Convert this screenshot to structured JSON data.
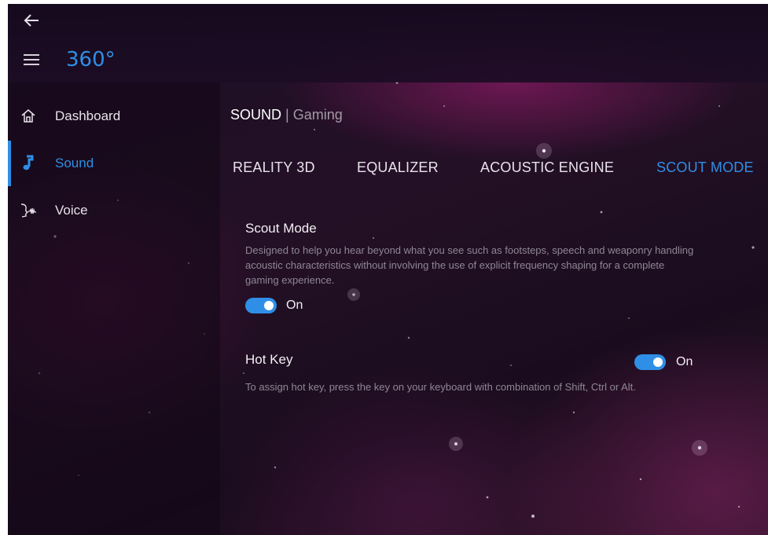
{
  "app": {
    "title": "360°",
    "back_icon": "arrow-left-icon",
    "menu_icon": "hamburger-menu-icon",
    "accent_color": "#2f8fe6"
  },
  "sidebar": {
    "items": [
      {
        "label": "Dashboard",
        "icon": "home-icon",
        "active": false
      },
      {
        "label": "Sound",
        "icon": "music-note-icon",
        "active": true
      },
      {
        "label": "Voice",
        "icon": "voice-wave-icon",
        "active": false
      }
    ]
  },
  "breadcrumb": {
    "section": "SOUND",
    "separator": "|",
    "subsection": "Gaming"
  },
  "tabs": [
    {
      "label": "REALITY 3D",
      "active": false
    },
    {
      "label": "EQUALIZER",
      "active": false
    },
    {
      "label": "ACOUSTIC ENGINE",
      "active": false
    },
    {
      "label": "SCOUT MODE",
      "active": true
    }
  ],
  "scout_mode": {
    "title": "Scout Mode",
    "description_lines": [
      "Designed to help you hear beyond what you see such as footsteps, speech and weaponry handling",
      "acoustic characteristics without involving the use of explicit frequency shaping for a complete",
      "gaming experience."
    ],
    "toggle_state": "On",
    "enabled": true
  },
  "hot_key": {
    "title": "Hot Key",
    "description": "To assign hot key, press the key on your keyboard with combination of Shift, Ctrl or Alt.",
    "toggle_state": "On",
    "enabled": true
  }
}
